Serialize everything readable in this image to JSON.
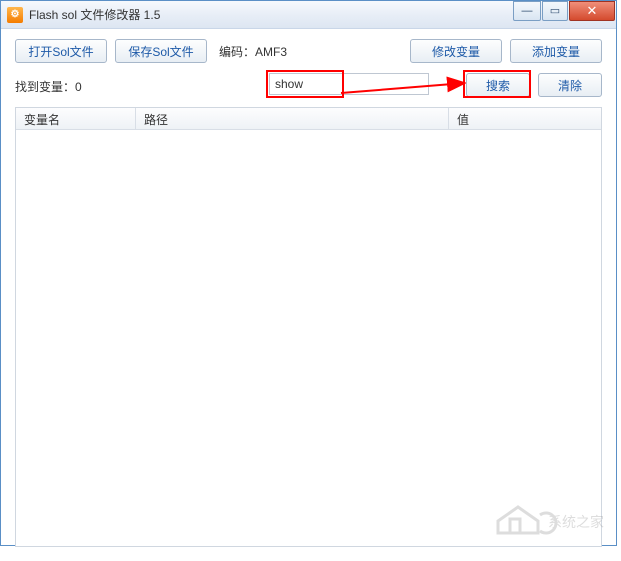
{
  "titlebar": {
    "title": "Flash sol 文件修改器 1.5"
  },
  "toolbar": {
    "open_label": "打开Sol文件",
    "save_label": "保存Sol文件",
    "encoding_label": "编码：",
    "encoding_value": "AMF3",
    "modify_label": "修改变量",
    "add_label": "添加变量"
  },
  "searchbar": {
    "count_label": "找到变量：",
    "count_value": "0",
    "input_value": "show",
    "search_label": "搜索",
    "clear_label": "清除"
  },
  "table": {
    "col_name": "变量名",
    "col_path": "路径",
    "col_value": "值"
  },
  "watermark": {
    "text": "系统之家"
  },
  "winctrl": {
    "min": "—",
    "max": "▭",
    "close": "✕"
  }
}
